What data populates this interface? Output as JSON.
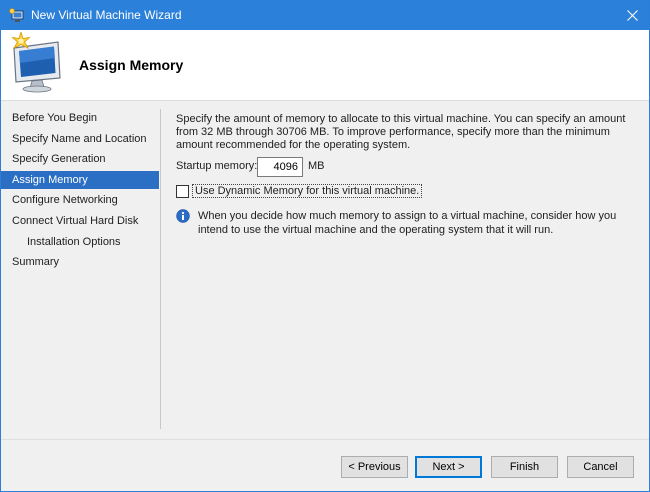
{
  "window": {
    "title": "New Virtual Machine Wizard",
    "colors": {
      "titlebar": "#2b80d9",
      "nav_active": "#2b6fc4",
      "info_icon": "#2a6cc7"
    },
    "icons": {
      "app": "hyper-v-vm-icon",
      "close": "close-icon",
      "header": "monitor-starburst-icon",
      "info": "info-icon"
    }
  },
  "header": {
    "title": "Assign Memory"
  },
  "nav": {
    "items": [
      {
        "label": "Before You Begin"
      },
      {
        "label": "Specify Name and Location"
      },
      {
        "label": "Specify Generation"
      },
      {
        "label": "Assign Memory"
      },
      {
        "label": "Configure Networking"
      },
      {
        "label": "Connect Virtual Hard Disk"
      },
      {
        "label": "Installation Options"
      },
      {
        "label": "Summary"
      }
    ],
    "active": "Assign Memory"
  },
  "content": {
    "description": "Specify the amount of memory to allocate to this virtual machine. You can specify an amount from 32 MB through 30706 MB. To improve performance, specify more than the minimum amount recommended for the operating system.",
    "startup_memory": {
      "label": "Startup memory:",
      "value": "4096",
      "unit": "MB"
    },
    "dynamic_memory": {
      "label": "Use Dynamic Memory for this virtual machine.",
      "checked": false
    },
    "info_text": "When you decide how much memory to assign to a virtual machine, consider how you intend to use the virtual machine and the operating system that it will run."
  },
  "buttons": {
    "previous": "< Previous",
    "next": "Next >",
    "finish": "Finish",
    "cancel": "Cancel"
  }
}
